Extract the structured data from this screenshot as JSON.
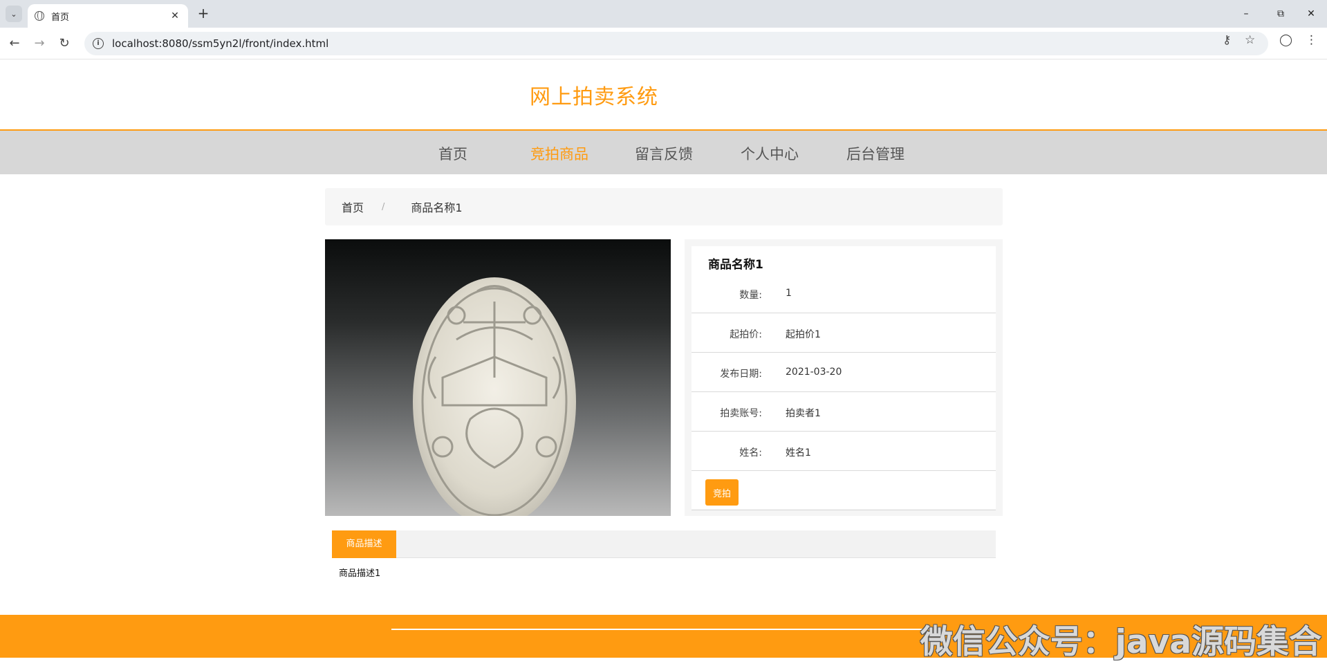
{
  "browser": {
    "tab_title": "首页",
    "url": "localhost:8080/ssm5yn2l/front/index.html"
  },
  "site": {
    "title": "网上拍卖系统",
    "nav": [
      {
        "label": "首页",
        "active": false
      },
      {
        "label": "竞拍商品",
        "active": true
      },
      {
        "label": "留言反馈",
        "active": false
      },
      {
        "label": "个人中心",
        "active": false
      },
      {
        "label": "后台管理",
        "active": false
      }
    ]
  },
  "breadcrumb": {
    "home": "首页",
    "separator": "/",
    "current": "商品名称1"
  },
  "product": {
    "name": "商品名称1",
    "fields": [
      {
        "label": "数量:",
        "value": "1"
      },
      {
        "label": "起拍价:",
        "value": "起拍价1"
      },
      {
        "label": "发布日期:",
        "value": "2021-03-20"
      },
      {
        "label": "拍卖账号:",
        "value": "拍卖者1"
      },
      {
        "label": "姓名:",
        "value": "姓名1"
      }
    ],
    "bid_button": "竞拍",
    "description_tab": "商品描述",
    "description": "商品描述1"
  },
  "footer": {
    "watermark": "微信公众号：java源码集合"
  },
  "colors": {
    "accent": "#ff9b11",
    "nav_bg": "#d7d7d7"
  }
}
